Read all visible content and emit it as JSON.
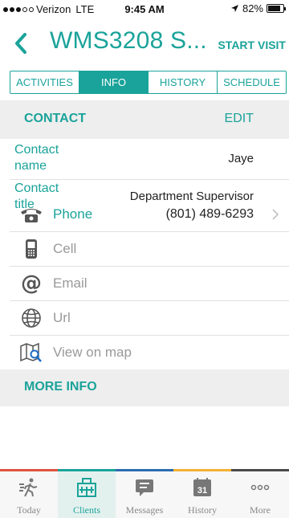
{
  "status_bar": {
    "carrier": "Verizon",
    "network": "LTE",
    "time": "9:45 AM",
    "battery_text": "82%",
    "battery_level": 0.82,
    "signal_bars_filled": 3,
    "signal_bars_total": 5
  },
  "header": {
    "title": "WMS3208 S...",
    "start_visit_label": "START VISIT"
  },
  "tabs": [
    {
      "label": "ACTIVITIES",
      "active": false
    },
    {
      "label": "INFO",
      "active": true
    },
    {
      "label": "HISTORY",
      "active": false
    },
    {
      "label": "SCHEDULE",
      "active": false
    }
  ],
  "contact_section": {
    "title": "CONTACT",
    "edit_label": "EDIT"
  },
  "contact_fields": [
    {
      "label_line1": "Contact",
      "label_line2": "name",
      "value": "Jaye"
    },
    {
      "label_line1": "Contact",
      "label_line2": "title",
      "value": "Department Supervisor"
    }
  ],
  "details": [
    {
      "icon": "telephone-icon",
      "label": "Phone",
      "value": "(801) 489-6293",
      "active": true
    },
    {
      "icon": "cellphone-icon",
      "label": "Cell",
      "value": "",
      "active": false
    },
    {
      "icon": "at-sign-icon",
      "label": "Email",
      "value": "",
      "active": false
    },
    {
      "icon": "globe-icon",
      "label": "Url",
      "value": "",
      "active": false
    },
    {
      "icon": "map-search-icon",
      "label": "View on map",
      "value": "",
      "active": false
    }
  ],
  "more_info_section": {
    "title": "MORE INFO"
  },
  "bottom_nav": [
    {
      "icon": "walking-person-icon",
      "label": "Today",
      "active": false
    },
    {
      "icon": "building-icon",
      "label": "Clients",
      "active": true
    },
    {
      "icon": "chat-bubble-icon",
      "label": "Messages",
      "active": false
    },
    {
      "icon": "calendar-icon",
      "label": "History",
      "active": false,
      "badge_text": "31"
    },
    {
      "icon": "more-dots-icon",
      "label": "More",
      "active": false
    }
  ],
  "colors": {
    "accent": "#1aa39a",
    "strip": [
      "#e0533f",
      "#1aa39a",
      "#2b6cb0",
      "#f2b134",
      "#4a4a4a"
    ]
  }
}
